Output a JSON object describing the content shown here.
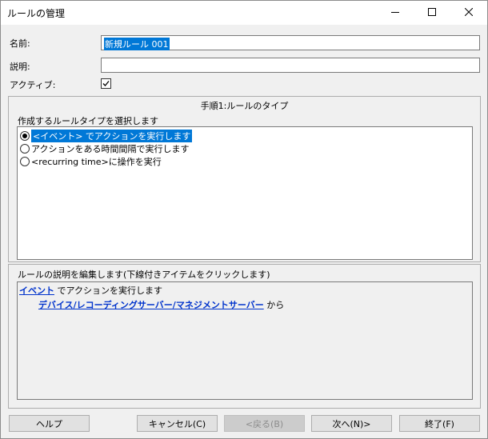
{
  "window": {
    "title": "ルールの管理"
  },
  "form": {
    "name_label": "名前:",
    "name_value": "新規ルール 001",
    "desc_label": "説明:",
    "active_label": "アクティブ:",
    "active_checked": true
  },
  "step": {
    "title": "手順1:ルールのタイプ",
    "prompt": "作成するルールタイプを選択します",
    "options": [
      {
        "label": "<イベント> でアクションを実行します",
        "selected": true
      },
      {
        "label": "アクションをある時間間隔で実行します",
        "selected": false
      },
      {
        "label": "<recurring time>に操作を実行",
        "selected": false
      }
    ]
  },
  "description": {
    "caption": "ルールの説明を編集します(下線付きアイテムをクリックします)",
    "line1_link": "イベント",
    "line1_text": " でアクションを実行します",
    "line2_link": "デバイス/レコーディングサーバー/マネジメントサーバー",
    "line2_text": " から"
  },
  "buttons": {
    "help": "ヘルプ",
    "cancel": "キャンセル(C)",
    "back": "<戻る(B)",
    "next": "次へ(N)>",
    "finish": "終了(F)"
  }
}
